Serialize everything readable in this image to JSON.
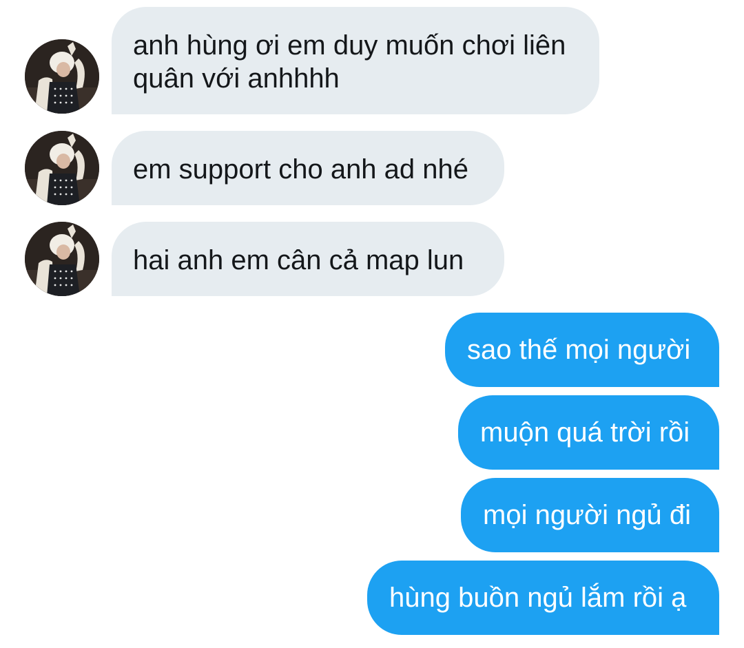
{
  "conversation": {
    "incoming": [
      {
        "text": "anh hùng ơi em duy muốn chơi liên\nquân với anhhhh",
        "avatar_icon": "user-avatar-icon"
      },
      {
        "text": "em support cho anh ad nhé",
        "avatar_icon": "user-avatar-icon"
      },
      {
        "text": "hai anh em cân cả map lun",
        "avatar_icon": "user-avatar-icon"
      }
    ],
    "outgoing": [
      {
        "text": "sao thế mọi người"
      },
      {
        "text": "muộn quá trời rồi"
      },
      {
        "text": "mọi người ngủ đi"
      },
      {
        "text": "hùng buồn ngủ lắm rồi ạ"
      }
    ]
  },
  "colors": {
    "incoming_bubble": "#e6ecf0",
    "incoming_text": "#14171a",
    "outgoing_bubble": "#1da1f2",
    "outgoing_text": "#ffffff",
    "background": "#ffffff"
  }
}
